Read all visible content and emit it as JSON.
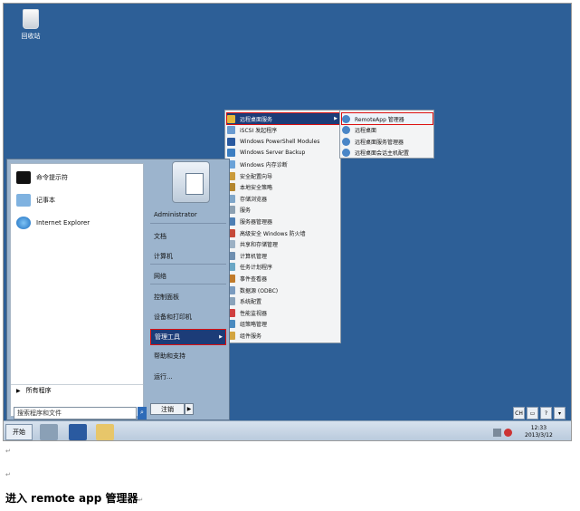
{
  "desktop": {
    "recycle_bin_label": "回收站"
  },
  "start_menu": {
    "pinned": [
      {
        "label": "命令提示符",
        "icon": "cmd-icon"
      },
      {
        "label": "记事本",
        "icon": "notepad-icon"
      },
      {
        "label": "Internet Explorer",
        "icon": "ie-icon"
      }
    ],
    "all_programs": "所有程序",
    "search_placeholder": "搜索程序和文件",
    "right_items": [
      "Administrator",
      "文档",
      "计算机",
      "网络",
      "控制面板",
      "设备和打印机",
      "管理工具",
      "帮助和支持",
      "运行..."
    ],
    "shutdown_label": "注销"
  },
  "admin_tools_menu": [
    {
      "label": "远程桌面服务",
      "icon": "folder-icon",
      "submenu": true
    },
    {
      "label": "iSCSI 发起程序",
      "icon": "iscsi-icon"
    },
    {
      "label": "Windows PowerShell Modules",
      "icon": "powershell-icon"
    },
    {
      "label": "Windows Server Backup",
      "icon": "backup-icon"
    },
    {
      "label": "Windows 内存诊断",
      "icon": "memory-icon"
    },
    {
      "label": "安全配置向导",
      "icon": "security-wizard-icon"
    },
    {
      "label": "本地安全策略",
      "icon": "policy-icon"
    },
    {
      "label": "存储浏览器",
      "icon": "storage-icon"
    },
    {
      "label": "服务",
      "icon": "services-icon"
    },
    {
      "label": "服务器管理器",
      "icon": "server-manager-icon"
    },
    {
      "label": "高级安全 Windows 防火墙",
      "icon": "firewall-icon"
    },
    {
      "label": "共享和存储管理",
      "icon": "share-icon"
    },
    {
      "label": "计算机管理",
      "icon": "computer-management-icon"
    },
    {
      "label": "任务计划程序",
      "icon": "clock-icon"
    },
    {
      "label": "事件查看器",
      "icon": "event-viewer-icon"
    },
    {
      "label": "数据源 (ODBC)",
      "icon": "odbc-icon"
    },
    {
      "label": "系统配置",
      "icon": "config-icon"
    },
    {
      "label": "性能监视器",
      "icon": "performance-icon"
    },
    {
      "label": "组策略管理",
      "icon": "group-policy-icon"
    },
    {
      "label": "组件服务",
      "icon": "component-icon"
    }
  ],
  "rds_submenu": [
    "RemoteApp 管理器",
    "远程桌面",
    "远程桌面服务管理器",
    "远程桌面会话主机配置"
  ],
  "taskbar": {
    "start_label": "开始",
    "lang": [
      "CH"
    ],
    "time": "12:33",
    "date": "2013/3/12"
  },
  "document": {
    "heading": "进入 remote app  管理器",
    "para_mark": "↵"
  },
  "colors": {
    "desktop": "#2d5f97",
    "selection": "#1c3c78",
    "highlight_border": "#dd1111"
  }
}
